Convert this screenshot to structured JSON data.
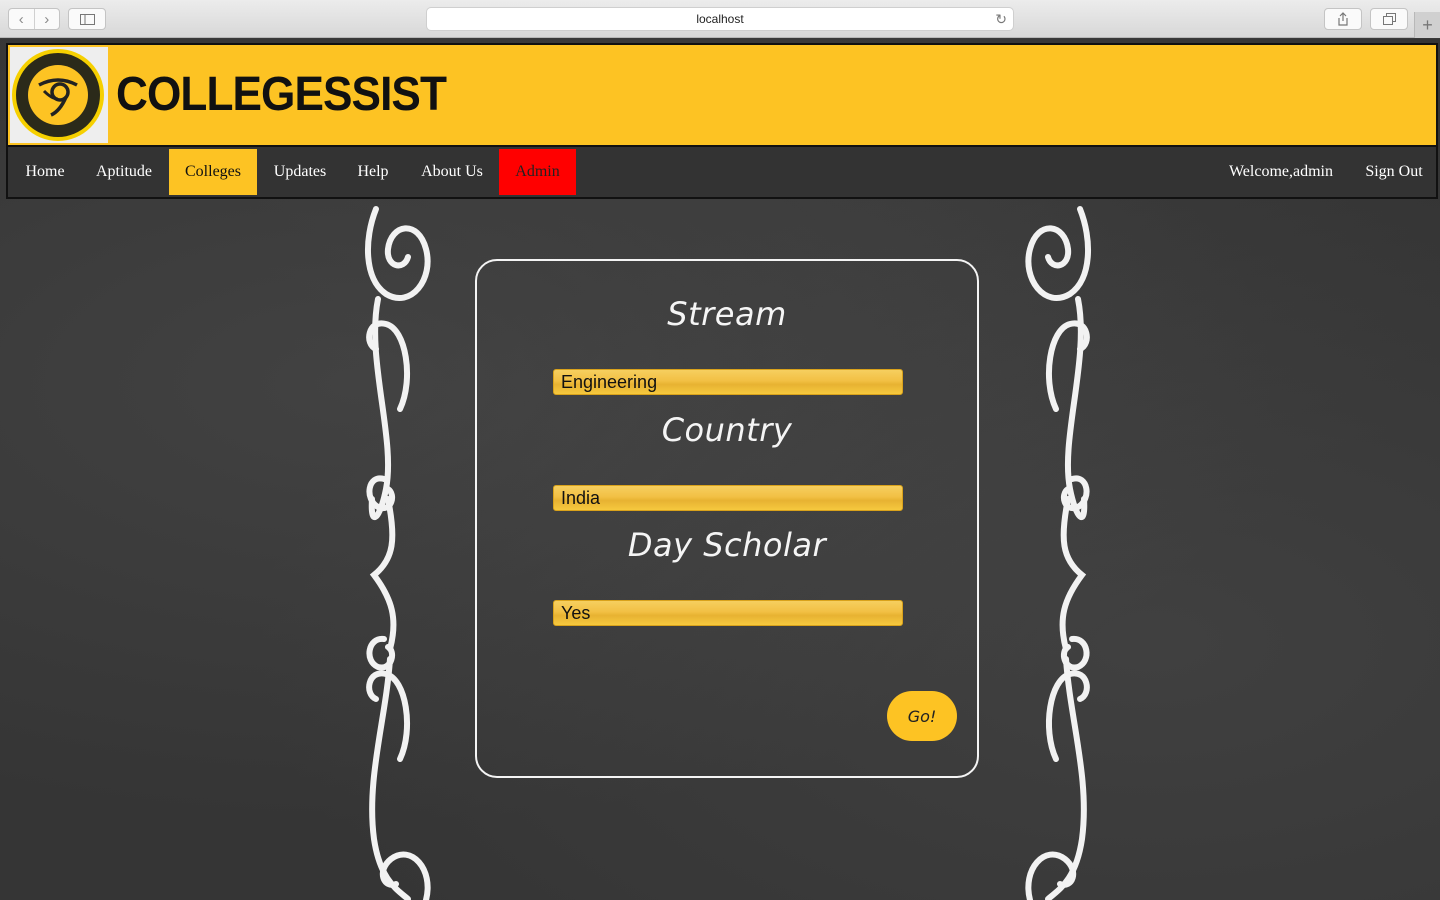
{
  "browser": {
    "url": "localhost"
  },
  "header": {
    "brand": "COLLEGESSIST"
  },
  "nav": {
    "items": [
      {
        "label": "Home"
      },
      {
        "label": "Aptitude"
      },
      {
        "label": "Colleges",
        "active": true
      },
      {
        "label": "Updates"
      },
      {
        "label": "Help"
      },
      {
        "label": "About Us"
      },
      {
        "label": "Admin"
      }
    ],
    "welcome": "Welcome,admin",
    "sign_out": "Sign Out"
  },
  "form": {
    "stream_label": "Stream",
    "stream_value": "Engineering",
    "country_label": "Country",
    "country_value": "India",
    "dayscholar_label": "Day Scholar",
    "dayscholar_value": "Yes",
    "go_label": "Go!"
  },
  "colors": {
    "accent": "#fdc323",
    "admin": "#ff0000",
    "nav_bg": "#333333",
    "chalkboard": "#353535"
  }
}
